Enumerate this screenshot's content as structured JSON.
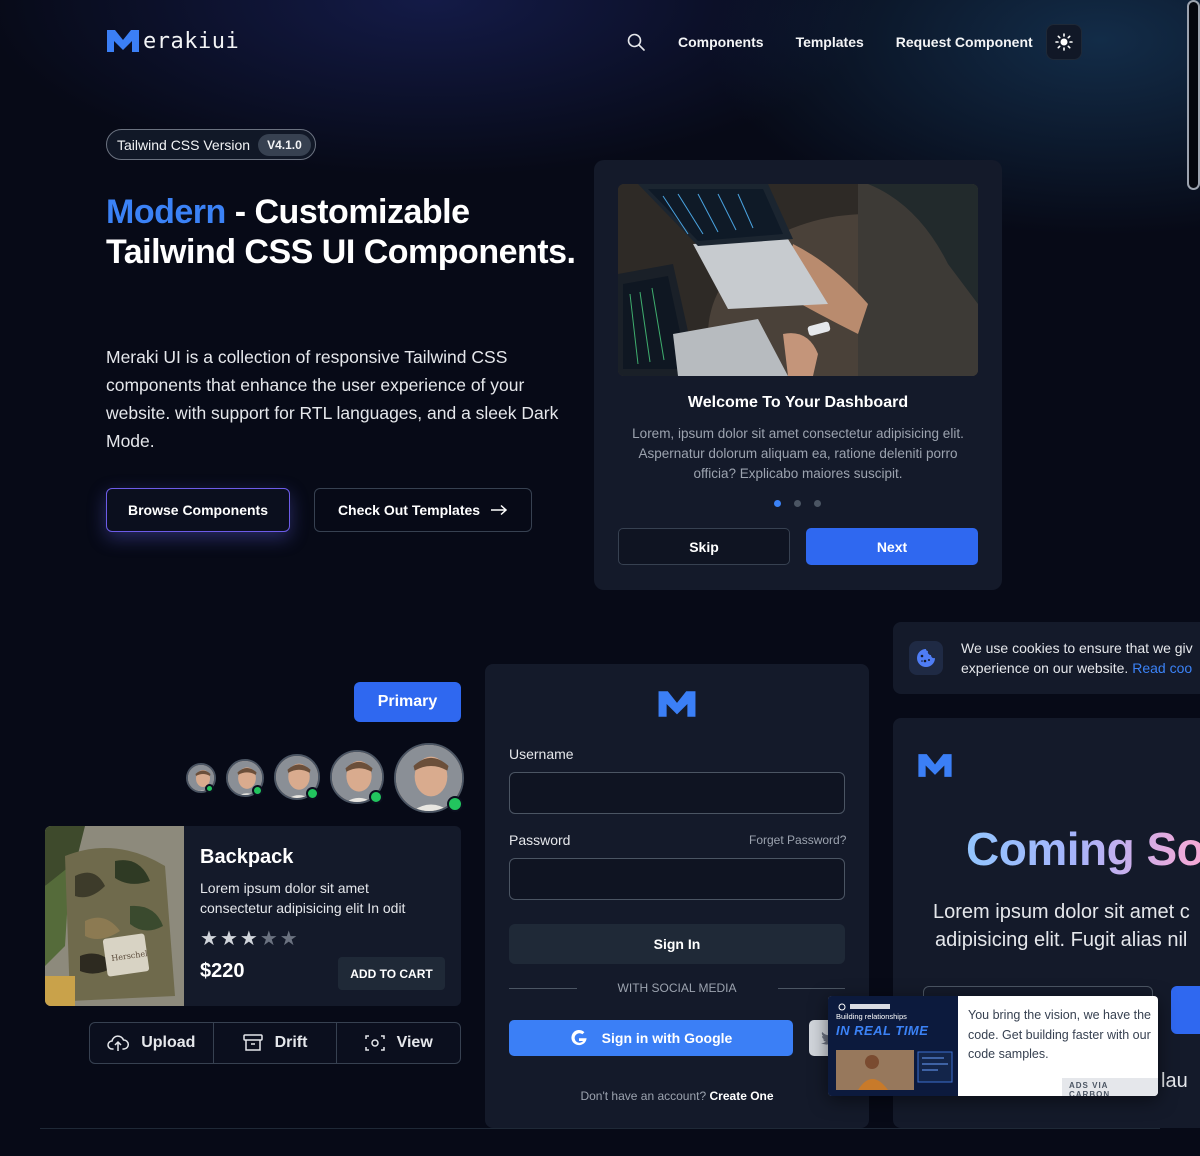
{
  "header": {
    "logo_text": "erakiui",
    "nav": [
      "Components",
      "Templates",
      "Request Component"
    ]
  },
  "hero": {
    "badge_label": "Tailwind CSS Version",
    "badge_version": "V4.1.0",
    "title_accent": "Modern",
    "title_rest": " - Customizable Tailwind CSS UI Components.",
    "description": "Meraki UI is a collection of responsive Tailwind CSS components that enhance the user experience of your website. with support for RTL languages, and a sleek Dark Mode.",
    "browse_label": "Browse Components",
    "templates_label": "Check Out Templates"
  },
  "dashboard": {
    "title": "Welcome To Your Dashboard",
    "text": "Lorem, ipsum dolor sit amet consectetur adipisicing elit. Aspernatur dolorum aliquam ea, ratione deleniti porro officia? Explicabo maiores suscipit.",
    "skip_label": "Skip",
    "next_label": "Next",
    "active_dot": 1,
    "dot_count": 3
  },
  "components": {
    "primary_label": "Primary",
    "product": {
      "title": "Backpack",
      "description": "Lorem ipsum dolor sit amet consectetur adipisicing elit In odit",
      "rating": 3,
      "rating_max": 5,
      "price": "$220",
      "cart_label": "ADD TO CART"
    },
    "button_group": [
      "Upload",
      "Drift",
      "View"
    ]
  },
  "login": {
    "username_label": "Username",
    "password_label": "Password",
    "forgot_label": "Forget Password?",
    "signin_label": "Sign In",
    "social_label": "WITH SOCIAL MEDIA",
    "google_label": "Sign in with Google",
    "signup_prefix": "Don't have an account?",
    "signup_link": "Create One"
  },
  "cookie": {
    "line1": "We use cookies to ensure that we giv",
    "line2": "experience on our website.",
    "link": "Read coo"
  },
  "coming": {
    "title": "Coming So",
    "line1": "Lorem ipsum dolor sit amet c",
    "line2": "adipisicing elit. Fugit alias nil",
    "foot": "lau"
  },
  "ad": {
    "img_caption_1": "Building relationships",
    "img_caption_2": "IN REAL TIME",
    "text": "You bring the vision, we have the code. Get building faster with our code samples.",
    "via": "ADS VIA CARBON"
  },
  "colors": {
    "accent": "#3b82f6",
    "primary_button": "#2f68f0",
    "background": "#070a17",
    "card": "#141a2a",
    "online": "#22c55e"
  }
}
